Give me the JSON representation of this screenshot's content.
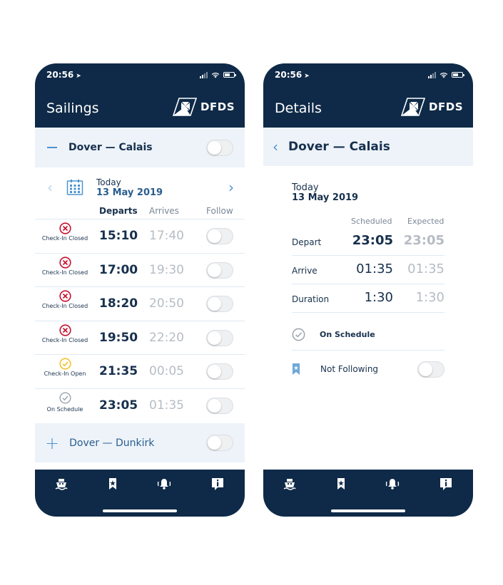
{
  "status_bar": {
    "time": "20:56"
  },
  "brand": {
    "name": "DFDS"
  },
  "colors": {
    "navy": "#0f2a48",
    "accent": "#4c93cf",
    "closed": "#c8102e",
    "open": "#f2c230",
    "muted": "#b6bcc4"
  },
  "sailings": {
    "title": "Sailings",
    "route": "Dover — Calais",
    "date": {
      "label": "Today",
      "value": "13 May 2019"
    },
    "columns": {
      "departs": "Departs",
      "arrives": "Arrives",
      "follow": "Follow"
    },
    "rows": [
      {
        "status_icon": "cross-circle-icon",
        "status": "Check-In Closed",
        "departs": "15:10",
        "arrives": "17:40"
      },
      {
        "status_icon": "cross-circle-icon",
        "status": "Check-In Closed",
        "departs": "17:00",
        "arrives": "19:30"
      },
      {
        "status_icon": "cross-circle-icon",
        "status": "Check-In Closed",
        "departs": "18:20",
        "arrives": "20:50"
      },
      {
        "status_icon": "cross-circle-icon",
        "status": "Check-In Closed",
        "departs": "19:50",
        "arrives": "22:20"
      },
      {
        "status_icon": "check-circle-yellow-icon",
        "status": "Check-In Open",
        "departs": "21:35",
        "arrives": "00:05"
      },
      {
        "status_icon": "check-circle-grey-icon",
        "status": "On Schedule",
        "departs": "23:05",
        "arrives": "01:35"
      }
    ],
    "other_route": "Dover — Dunkirk"
  },
  "details": {
    "title": "Details",
    "route": "Dover — Calais",
    "date": {
      "label": "Today",
      "value": "13 May 2019"
    },
    "columns": {
      "scheduled": "Scheduled",
      "expected": "Expected"
    },
    "depart": {
      "label": "Depart",
      "scheduled": "23:05",
      "expected": "23:05"
    },
    "arrive": {
      "label": "Arrive",
      "scheduled": "01:35",
      "expected": "01:35"
    },
    "duration": {
      "label": "Duration",
      "scheduled": "1:30",
      "expected": "1:30"
    },
    "status": "On Schedule",
    "follow_label": "Not Following"
  },
  "tabbar": [
    "ship-icon",
    "bookmark-icon",
    "bell-icon",
    "info-icon"
  ]
}
